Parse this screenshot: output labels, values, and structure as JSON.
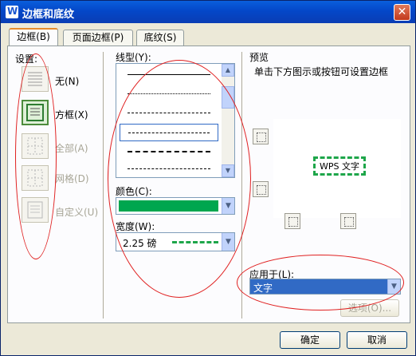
{
  "window": {
    "title": "边框和底纹",
    "app_icon": "W"
  },
  "tabs": [
    {
      "label": "边框(B)",
      "active": true
    },
    {
      "label": "页面边框(P)",
      "active": false
    },
    {
      "label": "底纹(S)",
      "active": false
    }
  ],
  "settings": {
    "label": "设置:",
    "items": [
      {
        "label": "无(N)",
        "selected": false,
        "enabled": true
      },
      {
        "label": "方框(X)",
        "selected": true,
        "enabled": true
      },
      {
        "label": "全部(A)",
        "selected": false,
        "enabled": false
      },
      {
        "label": "网格(D)",
        "selected": false,
        "enabled": false
      },
      {
        "label": "自定义(U)",
        "selected": false,
        "enabled": false
      }
    ]
  },
  "line_style": {
    "label": "线型(Y):",
    "selected_index": 3
  },
  "color": {
    "label": "颜色(C):",
    "value_color": "#00a64f"
  },
  "width": {
    "label": "宽度(W):",
    "value": "2.25 磅",
    "line_color": "#1ea64a"
  },
  "preview": {
    "label": "预览",
    "instruction": "单击下方图示或按钮可设置边框",
    "sample_text": "WPS 文字"
  },
  "apply_to": {
    "label": "应用于(L):",
    "value": "文字"
  },
  "buttons": {
    "options": "选项(O)...",
    "ok": "确定",
    "cancel": "取消"
  },
  "colors": {
    "annotation_red": "#e02020",
    "selection_blue": "#316ac5"
  }
}
